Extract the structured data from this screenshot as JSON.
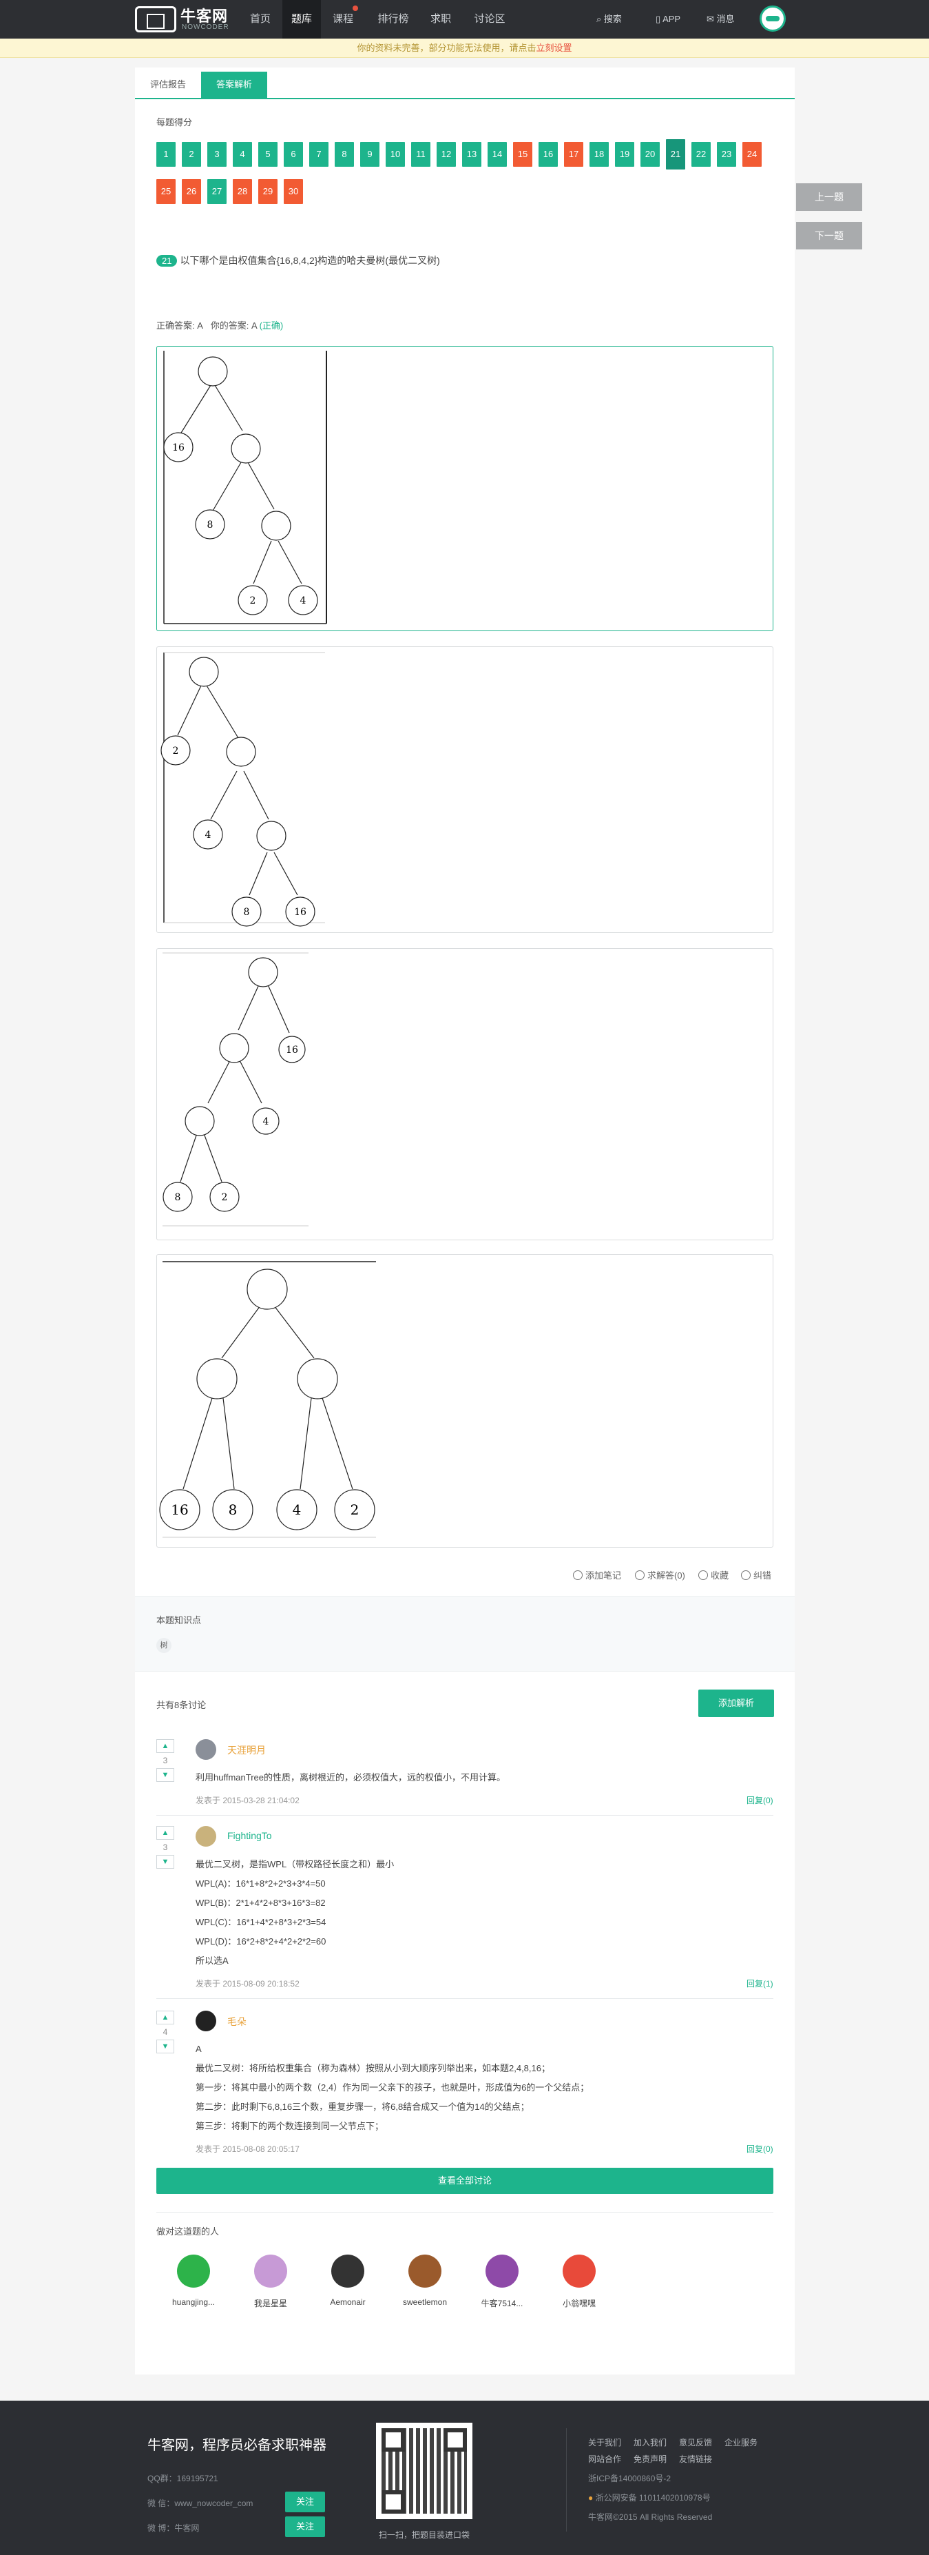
{
  "site": {
    "name": "牛客网",
    "sub": "NOWCODER"
  },
  "nav": [
    {
      "label": "首页"
    },
    {
      "label": "题库"
    },
    {
      "label": "课程"
    },
    {
      "label": "排行榜"
    },
    {
      "label": "求职"
    },
    {
      "label": "讨论区"
    }
  ],
  "tools": {
    "search": "搜索",
    "app": "APP",
    "msg": "消息"
  },
  "notice": {
    "text": "你的资料未完善，部分功能无法使用，请点击",
    "link": "立刻设置"
  },
  "tabs": {
    "report": "评估报告",
    "analysis": "答案解析"
  },
  "score": {
    "label": "每题得分",
    "items": [
      {
        "n": "1",
        "s": "g"
      },
      {
        "n": "2",
        "s": "g"
      },
      {
        "n": "3",
        "s": "g"
      },
      {
        "n": "4",
        "s": "g"
      },
      {
        "n": "5",
        "s": "g"
      },
      {
        "n": "6",
        "s": "g"
      },
      {
        "n": "7",
        "s": "g"
      },
      {
        "n": "8",
        "s": "g"
      },
      {
        "n": "9",
        "s": "g"
      },
      {
        "n": "10",
        "s": "g"
      },
      {
        "n": "11",
        "s": "g"
      },
      {
        "n": "12",
        "s": "g"
      },
      {
        "n": "13",
        "s": "g"
      },
      {
        "n": "14",
        "s": "g"
      },
      {
        "n": "15",
        "s": "r"
      },
      {
        "n": "16",
        "s": "g"
      },
      {
        "n": "17",
        "s": "r"
      },
      {
        "n": "18",
        "s": "g"
      },
      {
        "n": "19",
        "s": "g"
      },
      {
        "n": "20",
        "s": "g"
      },
      {
        "n": "21",
        "s": "cur"
      },
      {
        "n": "22",
        "s": "g"
      },
      {
        "n": "23",
        "s": "g"
      },
      {
        "n": "24",
        "s": "r"
      },
      {
        "n": "25",
        "s": "r"
      },
      {
        "n": "26",
        "s": "r"
      },
      {
        "n": "27",
        "s": "g"
      },
      {
        "n": "28",
        "s": "r"
      },
      {
        "n": "29",
        "s": "r"
      },
      {
        "n": "30",
        "s": "r"
      }
    ]
  },
  "side": {
    "prev": "上一题",
    "next": "下一题"
  },
  "question": {
    "num": "21",
    "text": "以下哪个是由权值集合{16,8,4,2}构造的哈夫曼树(最优二叉树)"
  },
  "answer": {
    "correct_label": "正确答案: A",
    "mine_label": "你的答案: A",
    "status": "(正确)"
  },
  "trees": {
    "a": [
      "16",
      "8",
      "2",
      "4"
    ],
    "b": [
      "2",
      "4",
      "8",
      "16"
    ],
    "c": [
      "16",
      "4",
      "8",
      "2"
    ],
    "d": [
      "16",
      "8",
      "4",
      "2"
    ]
  },
  "actions": {
    "note": "添加笔记",
    "solve": "求解答(0)",
    "fav": "收藏",
    "err": "纠错"
  },
  "knowledge": {
    "title": "本题知识点",
    "tag": "树"
  },
  "discuss": {
    "count": "共有8条讨论",
    "add": "添加解析",
    "view_all": "查看全部讨论",
    "comments": [
      {
        "votes": "3",
        "name": "天涯明月",
        "lines": [
          "利用huffmanTree的性质，离树根近的，必须权值大，远的权值小，不用计算。"
        ],
        "time": "发表于 2015-03-28 21:04:02",
        "reply": "回复(0)",
        "color": "#e8a23b"
      },
      {
        "votes": "3",
        "name": "FightingTo",
        "lines": [
          "最优二叉树，是指WPL（带权路径长度之和）最小",
          "WPL(A)：16*1+8*2+2*3+3*4=50",
          "WPL(B)：2*1+4*2+8*3+16*3=82",
          "WPL(C)：16*1+4*2+8*3+2*3=54",
          "WPL(D)：16*2+8*2+4*2+2*2=60",
          "所以选A"
        ],
        "time": "发表于 2015-08-09 20:18:52",
        "reply": "回复(1)",
        "color": "#1db48c"
      },
      {
        "votes": "4",
        "name": "毛朵",
        "lines": [
          "A",
          "最优二叉树：将所给权重集合（称为森林）按照从小到大顺序列举出来，如本题2,4,8,16；",
          "第一步：将其中最小的两个数（2,4）作为同一父亲下的孩子，也就是叶，形成值为6的一个父结点；",
          "第二步：此时剩下6,8,16三个数，重复步骤一，将6,8结合成又一个值为14的父结点；",
          "第三步：将剩下的两个数连接到同一父节点下；"
        ],
        "time": "发表于 2015-08-08 20:05:17",
        "reply": "回复(0)",
        "color": "#e8a23b"
      }
    ]
  },
  "users": {
    "label": "做对这道题的人",
    "list": [
      "huangjing...",
      "我是星星",
      "Aemonair",
      "sweetlemon",
      "牛客7514...",
      "小翁嘿嘿"
    ]
  },
  "footer": {
    "slogan": "牛客网，程序员必备求职神器",
    "qq": "QQ群：169195721",
    "wx_label": "微 信：www_nowcoder_com",
    "wb_label": "微 博：牛客网",
    "follow": "关注",
    "qr_caption": "扫一扫，把题目装进口袋",
    "links": [
      [
        "关于我们",
        "加入我们",
        "意见反馈",
        "企业服务"
      ],
      [
        "网站合作",
        "免责声明",
        "友情链接"
      ]
    ],
    "icp": "浙ICP备14000860号-2",
    "police": "浙公网安备 11011402010978号",
    "copy": "牛客网©2015 All Rights Reserved"
  },
  "colors": {
    "accent": "#1db48c",
    "wrong": "#f25b33",
    "nav_bg": "#2d2f33"
  }
}
